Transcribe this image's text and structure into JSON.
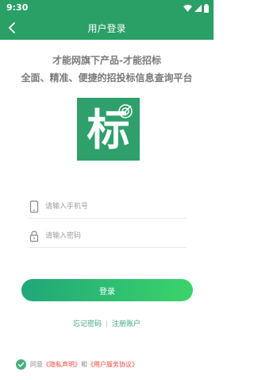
{
  "status_bar": {
    "time": "9:30"
  },
  "app_bar": {
    "title": "用户登录"
  },
  "header": {
    "line1": "才能网旗下产品-才能招标",
    "line2": "全面、精准、便捷的招投标信息查询平台"
  },
  "logo": {
    "char": "标"
  },
  "form": {
    "phone_placeholder": "请输入手机号",
    "password_placeholder": "请输入密码"
  },
  "login_button": "登录",
  "links": {
    "forgot": "忘记密码",
    "separator": "|",
    "register": "注册账户"
  },
  "agreement": {
    "prefix": "同意",
    "privacy": "《隐私声明》",
    "and": "和",
    "terms": "《用户服务协议》"
  },
  "colors": {
    "primary": "#2a9f66",
    "link": "#3aa878",
    "alert": "#f2473f"
  }
}
